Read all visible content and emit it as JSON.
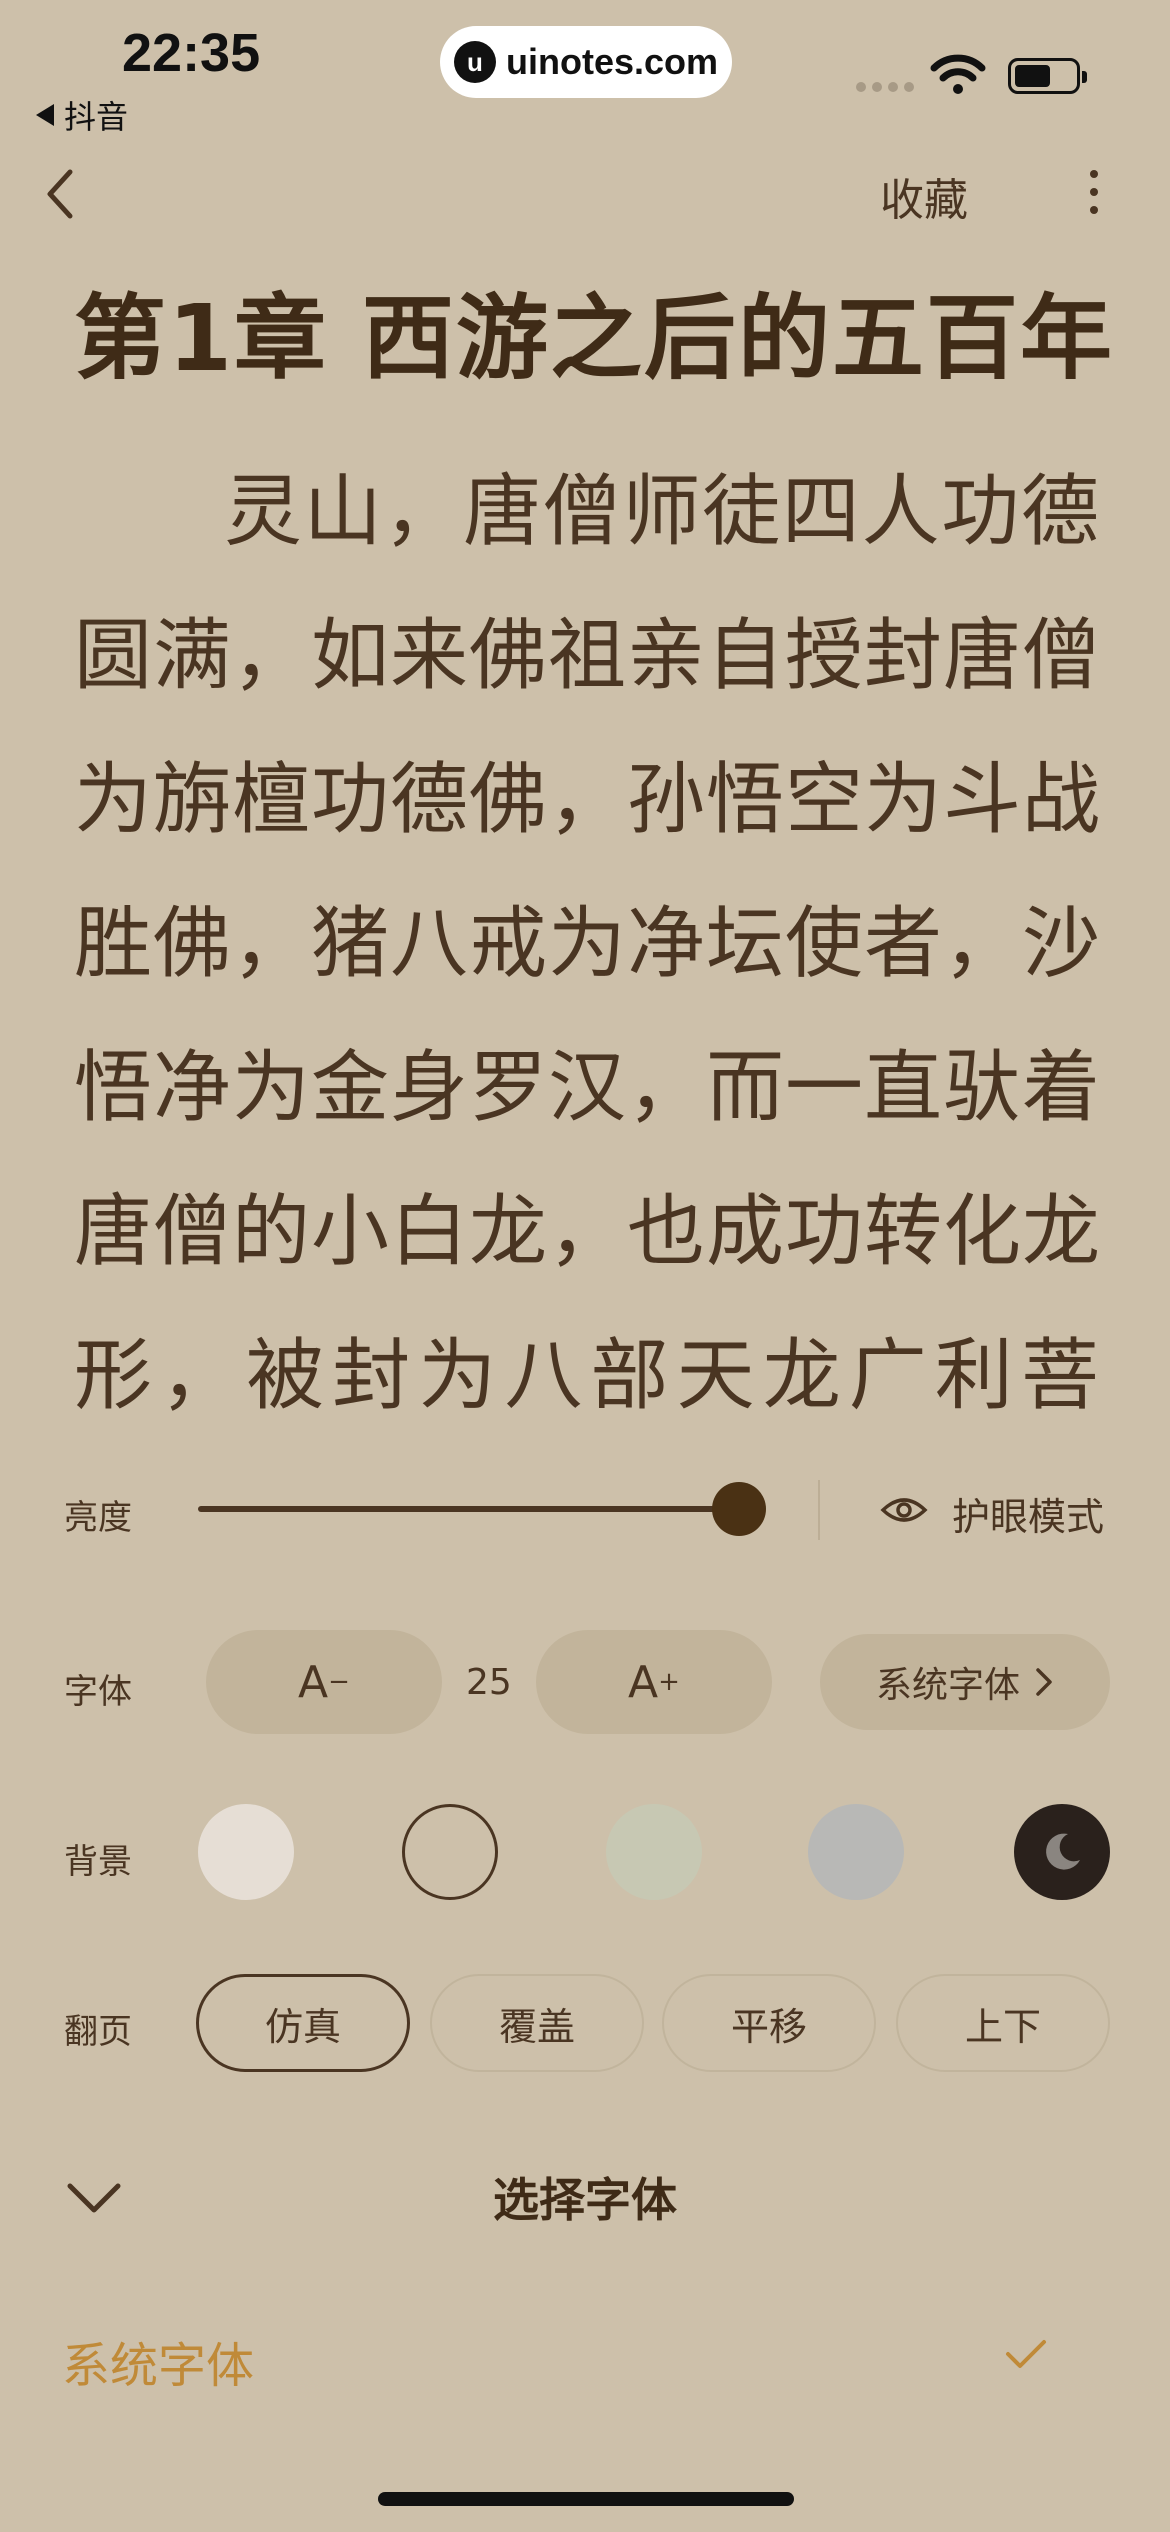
{
  "status_bar": {
    "time": "22:35",
    "back_app": "抖音",
    "watermark": "uinotes.com",
    "watermark_logo": "u"
  },
  "nav": {
    "favorite": "收藏",
    "icons": [
      "chevron-left-icon",
      "more-vertical-icon"
    ]
  },
  "chapter": {
    "title": "第1章 西游之后的五百年",
    "lines": [
      "灵山，唐僧师徒四人功德",
      "圆满，如来佛祖亲自授封唐僧",
      "为旃檀功德佛，孙悟空为斗战",
      "胜佛，猪八戒为净坛使者，沙",
      "悟净为金身罗汉，而一直驮着",
      "唐僧的小白龙，也成功转化龙",
      "形，被封为八部天龙广利菩"
    ]
  },
  "settings": {
    "brightness": {
      "label": "亮度",
      "level": 1.0,
      "eye_mode": "护眼模式"
    },
    "font": {
      "label": "字体",
      "decrease": "A",
      "decrease_mark": "−",
      "size": "25",
      "increase": "A",
      "increase_mark": "+",
      "face": "系统字体"
    },
    "background": {
      "label": "背景",
      "colors": [
        "#e6ded5",
        "#cdc0aa",
        "#c7c8b3",
        "#b8b8b6",
        "#2a211c"
      ],
      "selected_index": 1
    },
    "page_turn": {
      "label": "翻页",
      "options": [
        "仿真",
        "覆盖",
        "平移",
        "上下"
      ],
      "selected_index": 0
    }
  },
  "font_select": {
    "title": "选择字体",
    "options": [
      {
        "label": "系统字体",
        "selected": true
      }
    ]
  },
  "colors": {
    "accent": "#c08a38",
    "text": "#4a3522",
    "background": "#cdc0aa"
  }
}
